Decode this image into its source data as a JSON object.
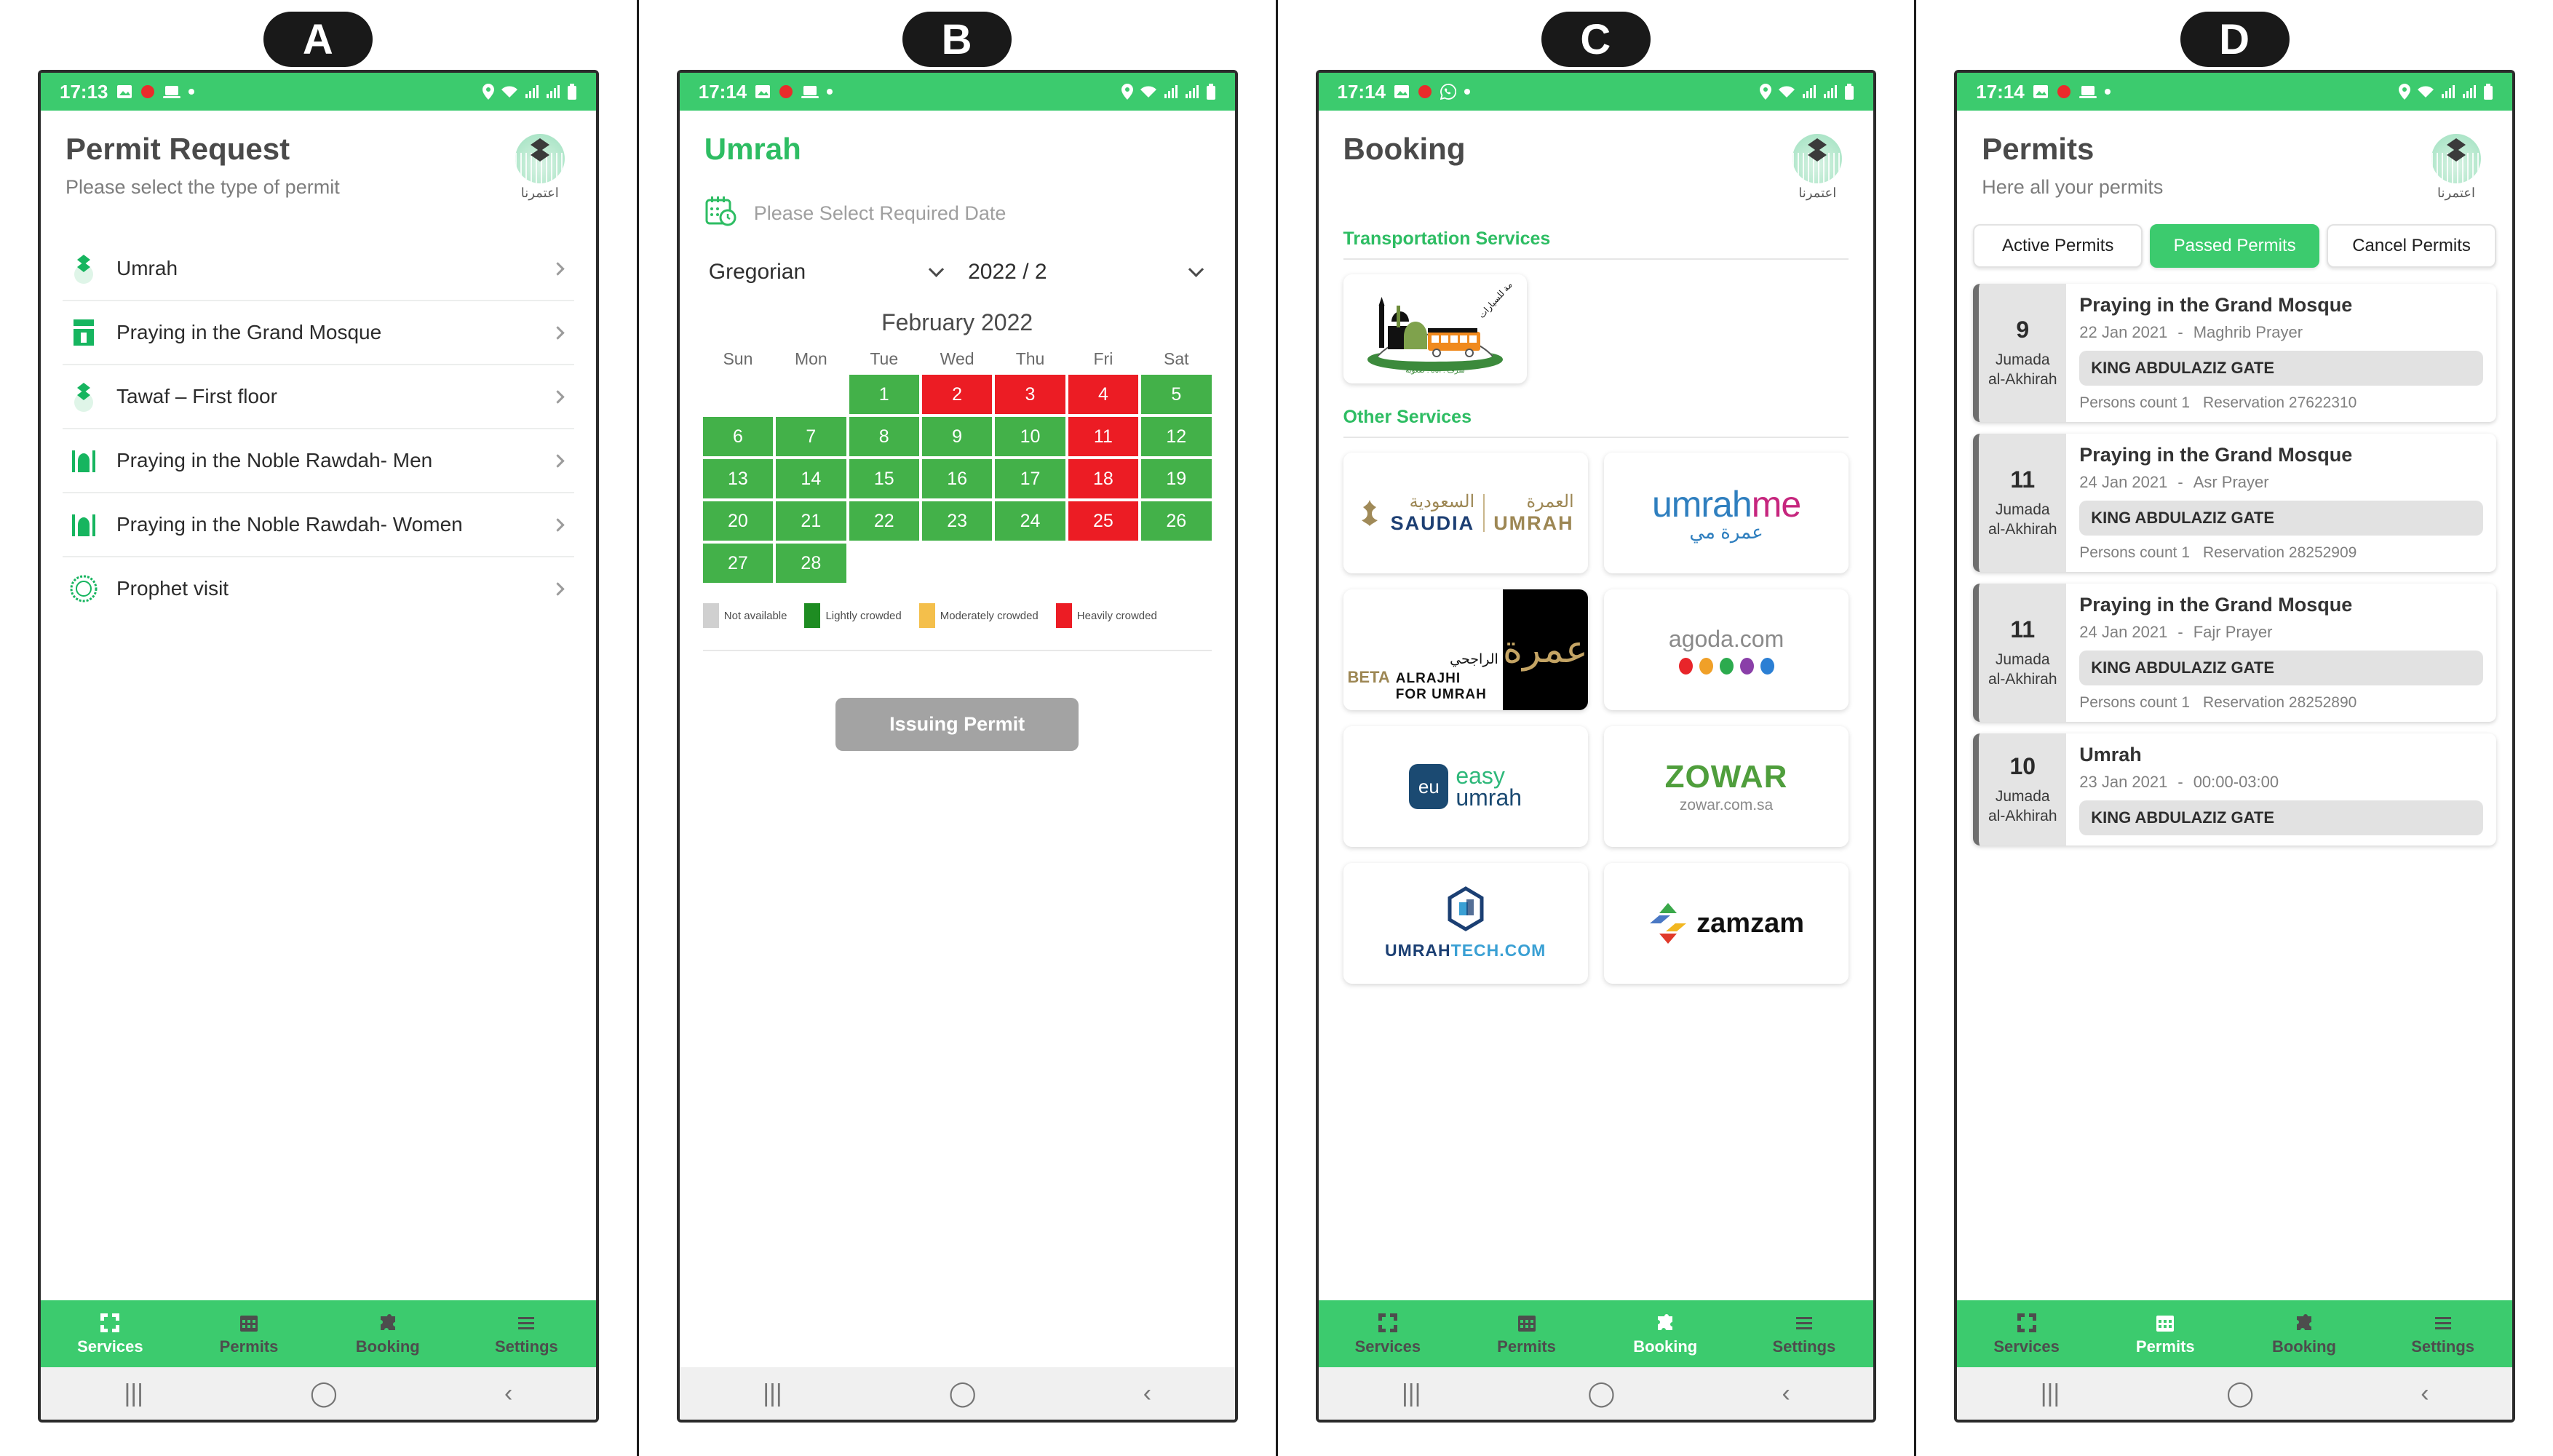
{
  "panels": {
    "a": {
      "tag": "A",
      "statusbar": {
        "time": "17:13",
        "icons": [
          "image-icon",
          "record-icon",
          "laptop-icon",
          "dot-icon"
        ],
        "right_icons": [
          "location-icon",
          "wifi-icon",
          "signal-icon",
          "signal2-icon",
          "battery-icon"
        ]
      },
      "title": "Permit Request",
      "subtitle": "Please select the type of permit",
      "brand": "اعتمرنا",
      "services": [
        {
          "label": "Umrah",
          "icon": "umrah-icon"
        },
        {
          "label": "Praying in the Grand Mosque",
          "icon": "kaaba-icon"
        },
        {
          "label": "Tawaf – First floor",
          "icon": "umrah-icon"
        },
        {
          "label": "Praying in the Noble Rawdah- Men",
          "icon": "mosque-icon"
        },
        {
          "label": "Praying in the Noble Rawdah- Women",
          "icon": "mosque-icon"
        },
        {
          "label": "Prophet visit",
          "icon": "seal-icon"
        }
      ],
      "nav": [
        {
          "label": "Services",
          "icon": "grid-icon",
          "active": true
        },
        {
          "label": "Permits",
          "icon": "calendar-icon",
          "active": false
        },
        {
          "label": "Booking",
          "icon": "puzzle-icon",
          "active": false
        },
        {
          "label": "Settings",
          "icon": "menu-icon",
          "active": false
        }
      ]
    },
    "b": {
      "tag": "B",
      "statusbar": {
        "time": "17:14"
      },
      "title": "Umrah",
      "date_placeholder": "Please Select Required Date",
      "calendar_type": "Gregorian",
      "year_month": "2022 / 2",
      "month_title": "February 2022",
      "dow": [
        "Sun",
        "Mon",
        "Tue",
        "Wed",
        "Thu",
        "Fri",
        "Sat"
      ],
      "leading_blanks": 2,
      "days": [
        {
          "n": "1",
          "s": "g"
        },
        {
          "n": "2",
          "s": "r"
        },
        {
          "n": "3",
          "s": "r"
        },
        {
          "n": "4",
          "s": "r"
        },
        {
          "n": "5",
          "s": "g"
        },
        {
          "n": "6",
          "s": "g"
        },
        {
          "n": "7",
          "s": "g"
        },
        {
          "n": "8",
          "s": "g"
        },
        {
          "n": "9",
          "s": "g"
        },
        {
          "n": "10",
          "s": "g"
        },
        {
          "n": "11",
          "s": "r"
        },
        {
          "n": "12",
          "s": "g"
        },
        {
          "n": "13",
          "s": "g"
        },
        {
          "n": "14",
          "s": "g"
        },
        {
          "n": "15",
          "s": "g"
        },
        {
          "n": "16",
          "s": "g"
        },
        {
          "n": "17",
          "s": "g"
        },
        {
          "n": "18",
          "s": "r"
        },
        {
          "n": "19",
          "s": "g"
        },
        {
          "n": "20",
          "s": "g"
        },
        {
          "n": "21",
          "s": "g"
        },
        {
          "n": "22",
          "s": "g"
        },
        {
          "n": "23",
          "s": "g"
        },
        {
          "n": "24",
          "s": "g"
        },
        {
          "n": "25",
          "s": "r"
        },
        {
          "n": "26",
          "s": "g"
        },
        {
          "n": "27",
          "s": "g"
        },
        {
          "n": "28",
          "s": "g"
        }
      ],
      "legend": [
        {
          "label": "Not available",
          "color": "#d0d0d0"
        },
        {
          "label": "Lightly crowded",
          "color": "#1e8c22"
        },
        {
          "label": "Moderately crowded",
          "color": "#f4bf4b"
        },
        {
          "label": "Heavily crowded",
          "color": "#ec1c24"
        }
      ],
      "issue_button": "Issuing Permit",
      "nav": [
        {
          "label": "Services",
          "active": false
        },
        {
          "label": "Permits",
          "active": false
        },
        {
          "label": "Booking",
          "active": false
        },
        {
          "label": "Settings",
          "active": false
        }
      ]
    },
    "c": {
      "tag": "C",
      "statusbar": {
        "time": "17:14"
      },
      "title": "Booking",
      "brand": "اعتمرنا",
      "section_transport": "Transportation Services",
      "section_other": "Other Services",
      "transport_logo": "saptco-bus-logo",
      "logos": [
        {
          "name": "saudia-umrah-logo",
          "ar": "العمرة",
          "ar2": "السعودية",
          "en": "SAUDIA",
          "en2": "UMRAH"
        },
        {
          "name": "umrahme-logo",
          "t1a": "umrah",
          "t1b": "me",
          "t2": "عمرة مي"
        },
        {
          "name": "alrajhi-umrah-logo",
          "beta": "BETA",
          "ar": "الراجحي",
          "en": "ALRAJHI",
          "en2": "FOR UMRAH"
        },
        {
          "name": "agoda-logo",
          "t": "agoda.com",
          "dots": [
            "#e8252a",
            "#f0a028",
            "#2cab4e",
            "#8a3fa8",
            "#2b7fd4"
          ]
        },
        {
          "name": "easy-umrah-logo",
          "mark": "eu",
          "w1": "easy",
          "w2": "umrah"
        },
        {
          "name": "zowar-logo",
          "t": "ZOWAR",
          "u": "zowar.com.sa"
        },
        {
          "name": "umrahtech-logo",
          "t1": "UMRAH",
          "t2": "TECH.COM"
        },
        {
          "name": "zamzam-logo",
          "t": "zamzam"
        }
      ],
      "nav": [
        {
          "label": "Services",
          "active": false
        },
        {
          "label": "Permits",
          "active": false
        },
        {
          "label": "Booking",
          "active": true
        },
        {
          "label": "Settings",
          "active": false
        }
      ]
    },
    "d": {
      "tag": "D",
      "statusbar": {
        "time": "17:14"
      },
      "title": "Permits",
      "subtitle": "Here all your permits",
      "brand": "اعتمرنا",
      "tabs": [
        {
          "label": "Active Permits",
          "active": false
        },
        {
          "label": "Passed Permits",
          "active": true
        },
        {
          "label": "Cancel Permits",
          "active": false
        }
      ],
      "permits": [
        {
          "day": "9",
          "month": "Jumada\nal-Akhirah",
          "title": "Praying in the Grand Mosque",
          "date": "22 Jan 2021",
          "time": "Maghrib Prayer",
          "gate": "KING ABDULAZIZ GATE",
          "persons": "Persons count 1",
          "reservation": "Reservation 27622310"
        },
        {
          "day": "11",
          "month": "Jumada\nal-Akhirah",
          "title": "Praying in the Grand Mosque",
          "date": "24 Jan 2021",
          "time": "Asr Prayer",
          "gate": "KING ABDULAZIZ GATE",
          "persons": "Persons count 1",
          "reservation": "Reservation 28252909"
        },
        {
          "day": "11",
          "month": "Jumada\nal-Akhirah",
          "title": "Praying in the Grand Mosque",
          "date": "24 Jan 2021",
          "time": "Fajr Prayer",
          "gate": "KING ABDULAZIZ GATE",
          "persons": "Persons count 1",
          "reservation": "Reservation 28252890"
        },
        {
          "day": "10",
          "month": "Jumada\nal-Akhirah",
          "title": "Umrah",
          "date": "23 Jan 2021",
          "time": "00:00-03:00",
          "gate": "KING ABDULAZIZ GATE",
          "persons": "",
          "reservation": ""
        }
      ],
      "nav": [
        {
          "label": "Services",
          "active": false
        },
        {
          "label": "Permits",
          "active": true
        },
        {
          "label": "Booking",
          "active": false
        },
        {
          "label": "Settings",
          "active": false
        }
      ]
    }
  },
  "colors": {
    "green": "#3ccb6e",
    "green_text": "#2ebd63",
    "red": "#ec1c24",
    "cal_green": "#43b149",
    "grey_btn": "#a3a3a3"
  }
}
